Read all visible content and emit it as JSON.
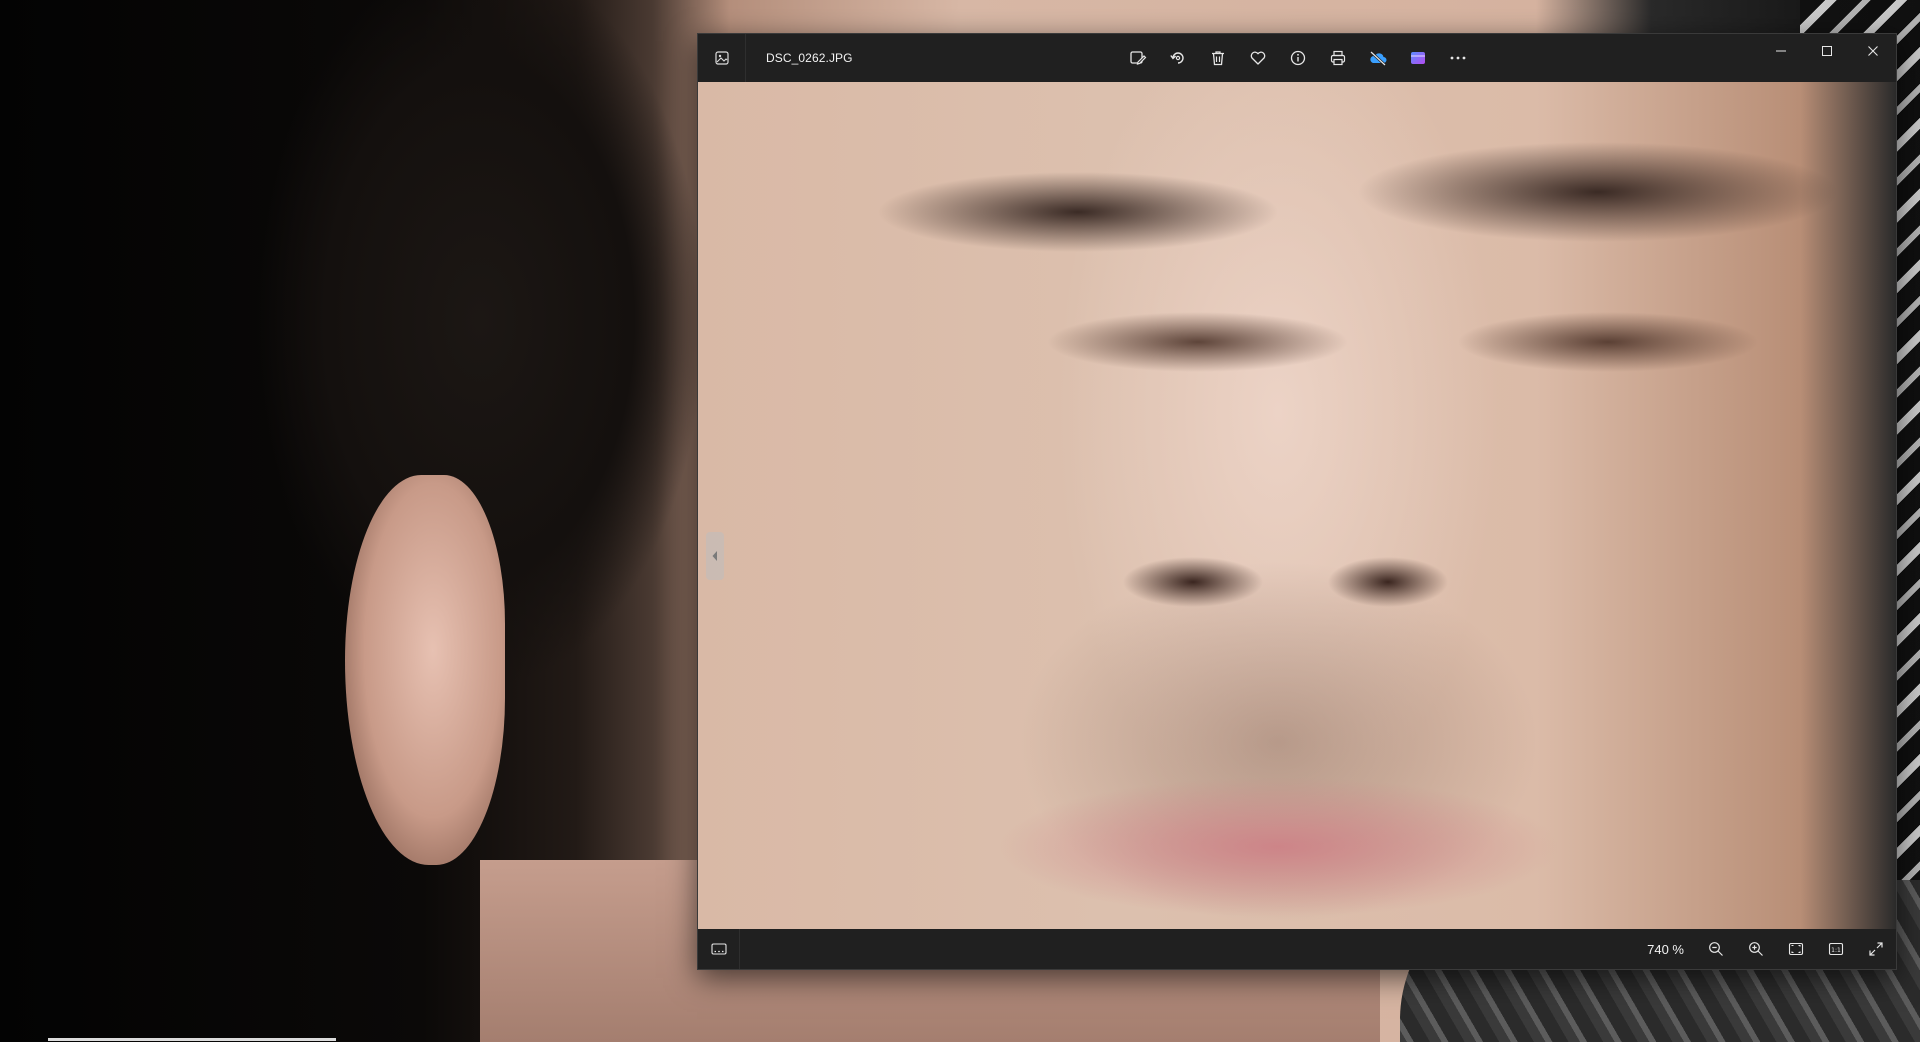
{
  "window": {
    "title": "DSC_0262.JPG"
  },
  "toolbar": {
    "items": [
      {
        "id": "edit",
        "icon": "edit-image-icon"
      },
      {
        "id": "rotate",
        "icon": "rotate-icon"
      },
      {
        "id": "delete",
        "icon": "delete-icon"
      },
      {
        "id": "favorite",
        "icon": "heart-icon"
      },
      {
        "id": "info",
        "icon": "info-icon"
      },
      {
        "id": "print",
        "icon": "print-icon"
      },
      {
        "id": "onedrive",
        "icon": "onedrive-off-icon"
      },
      {
        "id": "clipchamp",
        "icon": "clipchamp-icon"
      },
      {
        "id": "more",
        "icon": "more-icon"
      }
    ]
  },
  "statusbar": {
    "zoom_label": "740 %"
  },
  "colors": {
    "chrome": "#202020",
    "onedrive_blue": "#3aa0ff",
    "clipchamp_purple": "#8b5cf6"
  }
}
